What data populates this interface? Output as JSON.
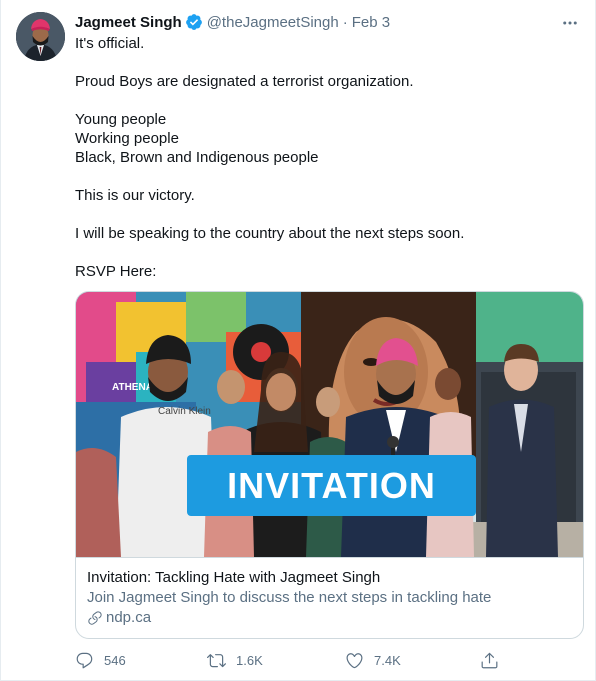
{
  "tweet": {
    "author_name": "Jagmeet Singh",
    "handle": "@theJagmeetSingh",
    "separator": "·",
    "date": "Feb 3",
    "body_lines": [
      "It's official.",
      "",
      "Proud Boys are designated a terrorist organization.",
      "",
      "Young people",
      "Working people",
      "Black, Brown and Indigenous people",
      "",
      "This is our victory.",
      "",
      "I will be speaking to the country about the next steps soon.",
      "",
      "RSVP Here:"
    ]
  },
  "card": {
    "banner_text": "INVITATION",
    "image_text": "Calvin Klein",
    "mural_text": "ATHENA",
    "title": "Invitation: Tackling Hate with Jagmeet Singh",
    "description": "Join Jagmeet Singh to discuss the next steps in tackling hate",
    "domain": "ndp.ca"
  },
  "actions": {
    "replies": "546",
    "retweets": "1.6K",
    "likes": "7.4K"
  },
  "colors": {
    "accent": "#1da1f2",
    "banner": "#1d9be0",
    "muted": "#5b7083",
    "text": "#0f1419"
  },
  "icons": [
    "verified-badge-icon",
    "more-icon",
    "link-icon",
    "reply-icon",
    "retweet-icon",
    "like-icon",
    "share-icon"
  ]
}
